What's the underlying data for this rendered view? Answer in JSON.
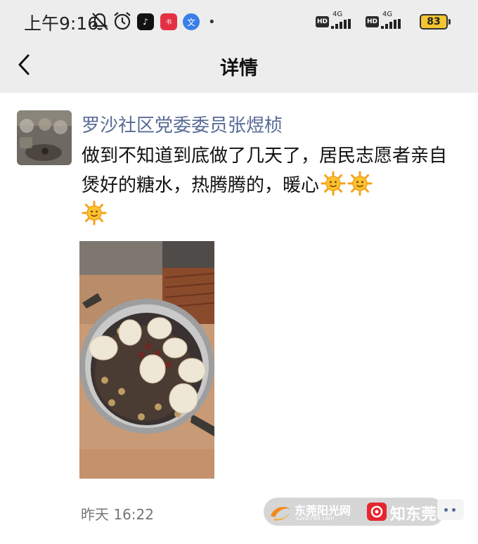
{
  "status_bar": {
    "time": "上午9:16",
    "icons": [
      "mute-bell-icon",
      "alarm-clock-icon",
      "tiktok-icon",
      "redbook-icon",
      "translate-icon",
      "more-dot-icon"
    ],
    "network_1": "4G",
    "network_2": "4G",
    "hd_label": "HD",
    "battery": "83",
    "battery_color": "#f3c531"
  },
  "nav": {
    "title": "详情",
    "back_icon": "chevron-left-icon"
  },
  "post": {
    "author": "罗沙社区党委委员张煜桢",
    "text": "做到不知道到底做了几天了，居民志愿者亲自煲好的糖水，热腾腾的，暖心",
    "emoji_icons": [
      "sun-emoji-icon",
      "sun-emoji-icon",
      "sun-emoji-icon"
    ],
    "image_icon": "sweet-soup-pot-photo",
    "time": "昨天 16:22",
    "author_color": "#576b95"
  },
  "watermark": {
    "site_name": "东莞阳光网",
    "site_url": "sun0769.com",
    "app_name": "知东莞"
  }
}
